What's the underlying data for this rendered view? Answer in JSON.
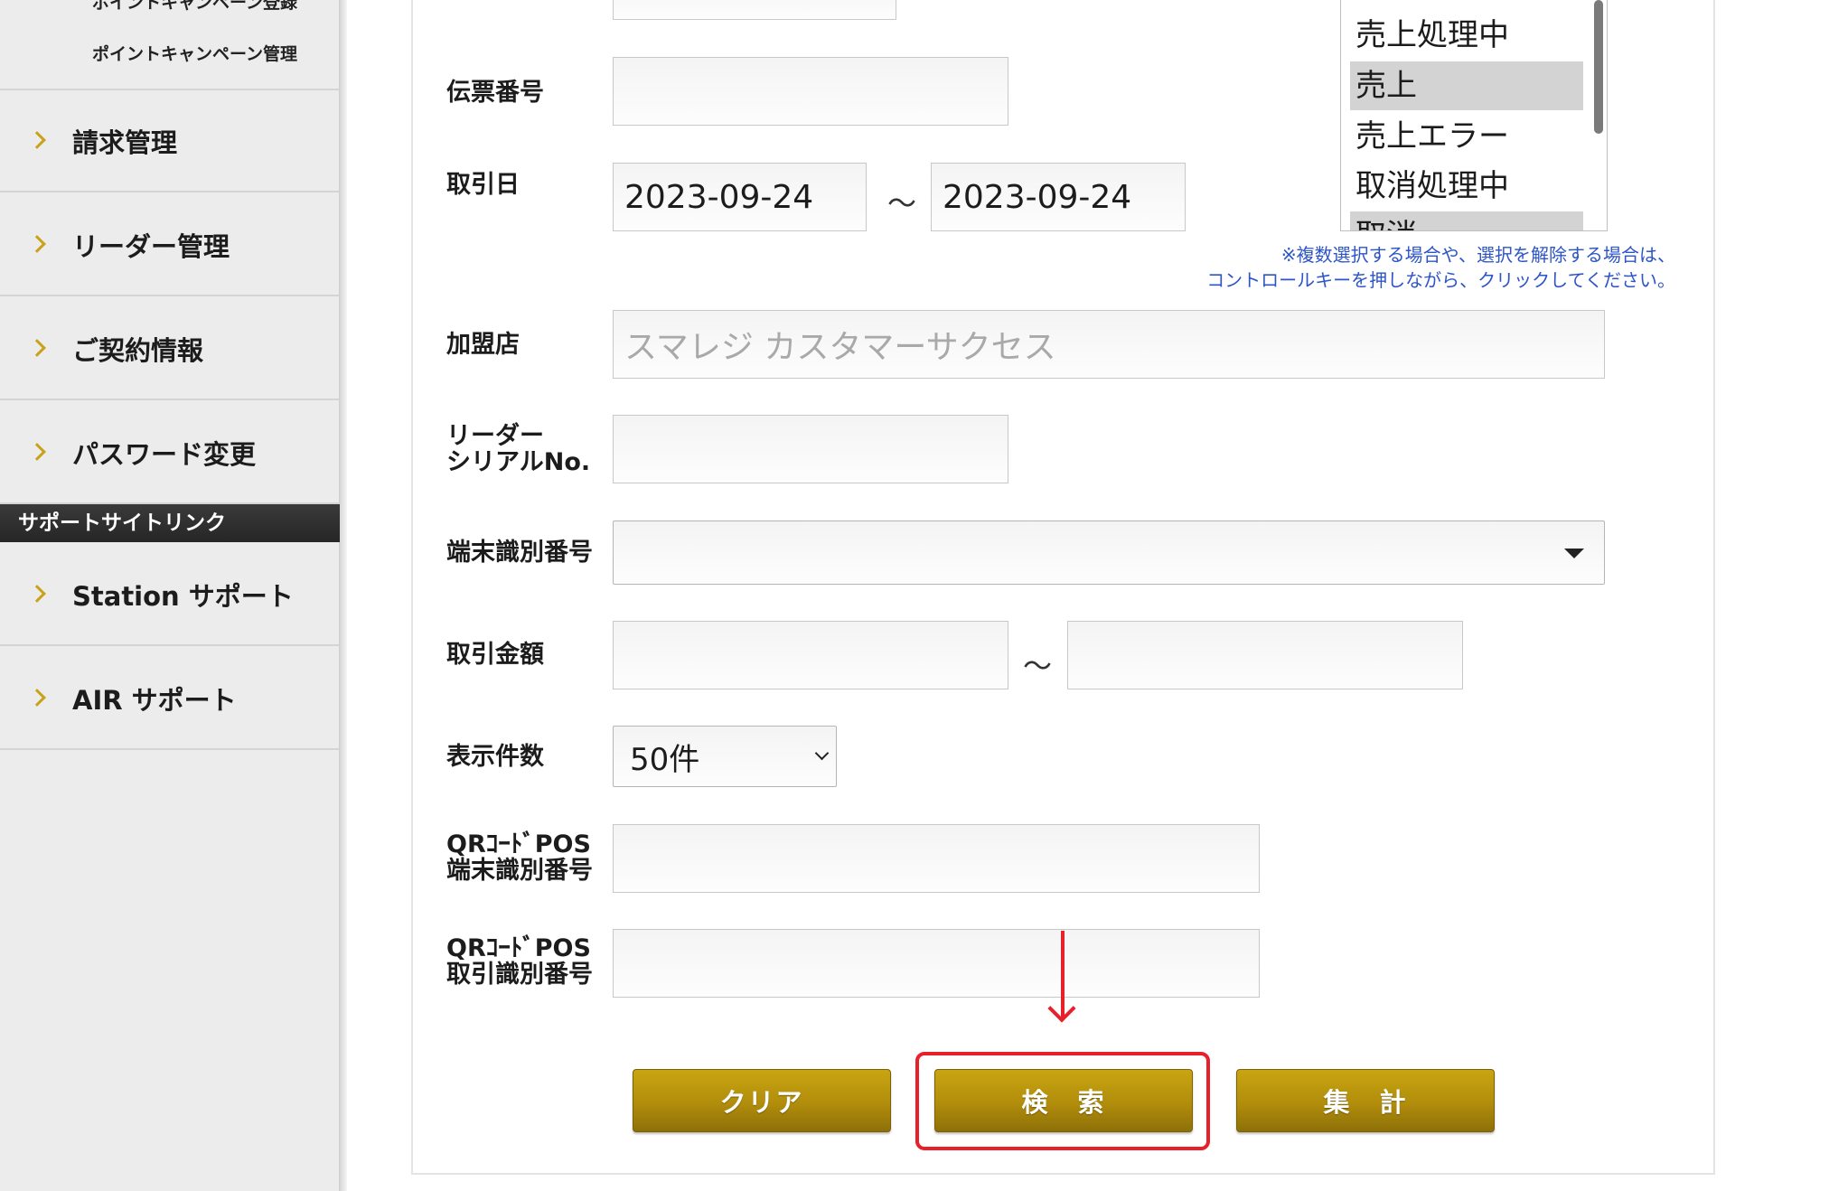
{
  "sidebar": {
    "sub_items": [
      "ポイントキャンペーン登録",
      "ポイントキャンペーン管理"
    ],
    "nav_items": [
      {
        "label": "請求管理"
      },
      {
        "label": "リーダー管理"
      },
      {
        "label": "ご契約情報"
      },
      {
        "label": "パスワード変更"
      }
    ],
    "section_header": "サポートサイトリンク",
    "support_items": [
      {
        "label": "Station サポート"
      },
      {
        "label": "AIR サポート"
      }
    ]
  },
  "status_list": {
    "options": [
      "売上処理中",
      "売上",
      "売上エラー",
      "取消処理中",
      "取消"
    ],
    "selected": "売上",
    "note_line1": "※複数選択する場合や、選択を解除する場合は、",
    "note_line2": "コントロールキーを押しながら、クリックしてください。"
  },
  "form": {
    "slip_number": {
      "label": "伝票番号",
      "value": ""
    },
    "transaction_date": {
      "label": "取引日",
      "from": "2023-09-24",
      "to": "2023-09-24",
      "separator": "～"
    },
    "merchant": {
      "label": "加盟店",
      "value": "スマレジ カスタマーサクセス"
    },
    "reader_serial": {
      "label_line1": "リーダー",
      "label_line2": "シリアルNo.",
      "value": ""
    },
    "terminal_id": {
      "label": "端末識別番号",
      "value": ""
    },
    "amount": {
      "label": "取引金額",
      "from": "",
      "to": "",
      "separator": "～"
    },
    "page_size": {
      "label": "表示件数",
      "value": "50件"
    },
    "qr_terminal_id": {
      "label_line1": "QRｺｰﾄﾞPOS",
      "label_line2": "端末識別番号",
      "value": ""
    },
    "qr_transaction_id": {
      "label_line1": "QRｺｰﾄﾞPOS",
      "label_line2": "取引識別番号",
      "value": ""
    }
  },
  "buttons": {
    "clear": "クリア",
    "search": "検　索",
    "aggregate": "集　計"
  },
  "colors": {
    "accent_gold": "#b8940c",
    "highlight_red": "#e8202a",
    "note_blue": "#2d55c6"
  }
}
